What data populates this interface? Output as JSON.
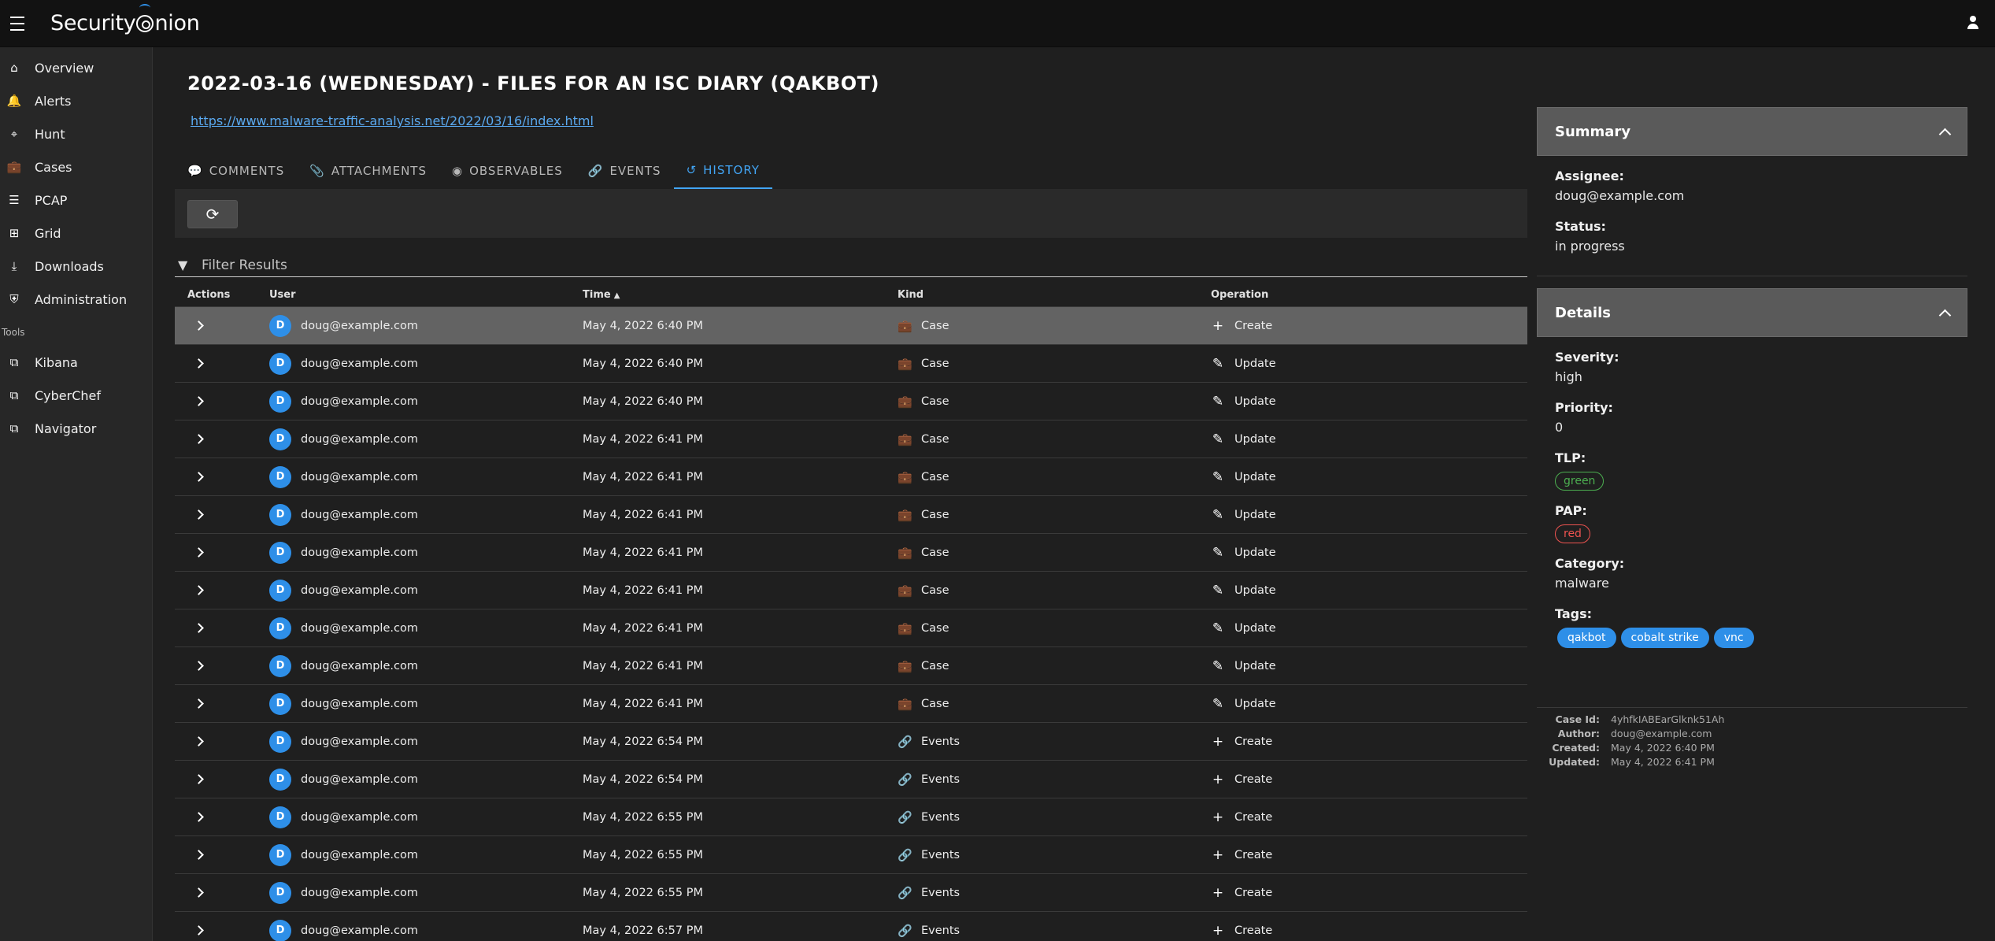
{
  "app": {
    "brand_part1": "Security",
    "brand_part2": "nion"
  },
  "nav": {
    "items": [
      {
        "label": "Overview",
        "icon": "home-icon"
      },
      {
        "label": "Alerts",
        "icon": "bell-icon"
      },
      {
        "label": "Hunt",
        "icon": "crosshairs-icon"
      },
      {
        "label": "Cases",
        "icon": "briefcase-icon"
      },
      {
        "label": "PCAP",
        "icon": "list-icon"
      },
      {
        "label": "Grid",
        "icon": "sitemap-icon"
      },
      {
        "label": "Downloads",
        "icon": "download-icon"
      },
      {
        "label": "Administration",
        "icon": "shield-icon"
      }
    ],
    "tools_label": "Tools",
    "tools": [
      {
        "label": "Kibana",
        "icon": "external-link-icon"
      },
      {
        "label": "CyberChef",
        "icon": "external-link-icon"
      },
      {
        "label": "Navigator",
        "icon": "external-link-icon"
      }
    ]
  },
  "case": {
    "title": "2022-03-16 (WEDNESDAY) - FILES FOR AN ISC DIARY (QAKBOT)",
    "link": "https://www.malware-traffic-analysis.net/2022/03/16/index.html"
  },
  "tabs": [
    {
      "label": "COMMENTS",
      "icon": "comments-icon"
    },
    {
      "label": "ATTACHMENTS",
      "icon": "paperclip-icon"
    },
    {
      "label": "OBSERVABLES",
      "icon": "eye-icon"
    },
    {
      "label": "EVENTS",
      "icon": "link-icon"
    },
    {
      "label": "HISTORY",
      "icon": "history-icon"
    }
  ],
  "filter": {
    "placeholder": "Filter Results"
  },
  "table": {
    "headers": {
      "actions": "Actions",
      "user": "User",
      "time": "Time",
      "kind": "Kind",
      "operation": "Operation"
    },
    "rows": [
      {
        "avatar": "D",
        "user": "doug@example.com",
        "time": "May 4, 2022 6:40 PM",
        "kind": "Case",
        "op": "Create"
      },
      {
        "avatar": "D",
        "user": "doug@example.com",
        "time": "May 4, 2022 6:40 PM",
        "kind": "Case",
        "op": "Update"
      },
      {
        "avatar": "D",
        "user": "doug@example.com",
        "time": "May 4, 2022 6:40 PM",
        "kind": "Case",
        "op": "Update"
      },
      {
        "avatar": "D",
        "user": "doug@example.com",
        "time": "May 4, 2022 6:41 PM",
        "kind": "Case",
        "op": "Update"
      },
      {
        "avatar": "D",
        "user": "doug@example.com",
        "time": "May 4, 2022 6:41 PM",
        "kind": "Case",
        "op": "Update"
      },
      {
        "avatar": "D",
        "user": "doug@example.com",
        "time": "May 4, 2022 6:41 PM",
        "kind": "Case",
        "op": "Update"
      },
      {
        "avatar": "D",
        "user": "doug@example.com",
        "time": "May 4, 2022 6:41 PM",
        "kind": "Case",
        "op": "Update"
      },
      {
        "avatar": "D",
        "user": "doug@example.com",
        "time": "May 4, 2022 6:41 PM",
        "kind": "Case",
        "op": "Update"
      },
      {
        "avatar": "D",
        "user": "doug@example.com",
        "time": "May 4, 2022 6:41 PM",
        "kind": "Case",
        "op": "Update"
      },
      {
        "avatar": "D",
        "user": "doug@example.com",
        "time": "May 4, 2022 6:41 PM",
        "kind": "Case",
        "op": "Update"
      },
      {
        "avatar": "D",
        "user": "doug@example.com",
        "time": "May 4, 2022 6:41 PM",
        "kind": "Case",
        "op": "Update"
      },
      {
        "avatar": "D",
        "user": "doug@example.com",
        "time": "May 4, 2022 6:54 PM",
        "kind": "Events",
        "op": "Create"
      },
      {
        "avatar": "D",
        "user": "doug@example.com",
        "time": "May 4, 2022 6:54 PM",
        "kind": "Events",
        "op": "Create"
      },
      {
        "avatar": "D",
        "user": "doug@example.com",
        "time": "May 4, 2022 6:55 PM",
        "kind": "Events",
        "op": "Create"
      },
      {
        "avatar": "D",
        "user": "doug@example.com",
        "time": "May 4, 2022 6:55 PM",
        "kind": "Events",
        "op": "Create"
      },
      {
        "avatar": "D",
        "user": "doug@example.com",
        "time": "May 4, 2022 6:55 PM",
        "kind": "Events",
        "op": "Create"
      },
      {
        "avatar": "D",
        "user": "doug@example.com",
        "time": "May 4, 2022 6:57 PM",
        "kind": "Events",
        "op": "Create"
      }
    ]
  },
  "summary": {
    "title": "Summary",
    "assignee_label": "Assignee:",
    "assignee": "doug@example.com",
    "status_label": "Status:",
    "status": "in progress"
  },
  "details": {
    "title": "Details",
    "severity_label": "Severity:",
    "severity": "high",
    "priority_label": "Priority:",
    "priority": "0",
    "tlp_label": "TLP:",
    "tlp": "green",
    "pap_label": "PAP:",
    "pap": "red",
    "category_label": "Category:",
    "category": "malware",
    "tags_label": "Tags:",
    "tags": [
      "qakbot",
      "cobalt strike",
      "vnc"
    ]
  },
  "meta": {
    "case_id_label": "Case Id:",
    "case_id": "4yhfkIABEarGlknk51Ah",
    "author_label": "Author:",
    "author": "doug@example.com",
    "created_label": "Created:",
    "created": "May 4, 2022 6:40 PM",
    "updated_label": "Updated:",
    "updated": "May 4, 2022 6:41 PM"
  },
  "colors": {
    "accent": "#42a5f5",
    "avatar": "#2e8fe8",
    "tlp_green": "#4caf50",
    "pap_red": "#ef5350"
  }
}
